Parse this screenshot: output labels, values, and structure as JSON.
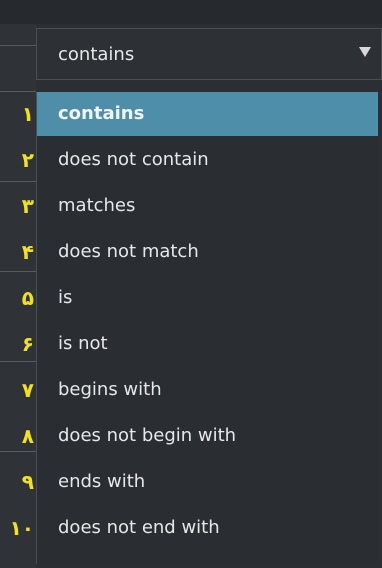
{
  "select": {
    "value": "contains",
    "caret_icon": "caret-down-icon"
  },
  "menu": {
    "options": [
      {
        "label": "contains",
        "selected": true
      },
      {
        "label": "does not contain",
        "selected": false
      },
      {
        "label": "matches",
        "selected": false
      },
      {
        "label": "does not match",
        "selected": false
      },
      {
        "label": "is",
        "selected": false
      },
      {
        "label": "is not",
        "selected": false
      },
      {
        "label": "begins with",
        "selected": false
      },
      {
        "label": "does not begin with",
        "selected": false
      },
      {
        "label": "ends with",
        "selected": false
      },
      {
        "label": "does not end with",
        "selected": false
      }
    ]
  },
  "annotations": {
    "numbers": [
      "۱",
      "۲",
      "۳",
      "۴",
      "۵",
      "۶",
      "۷",
      "۸",
      "۹",
      "۱۰"
    ],
    "color": "#f3e21a"
  },
  "colors": {
    "selected_bg": "#4e8ea8",
    "menu_bg": "#2a2d32",
    "text": "#e6e8ea"
  }
}
